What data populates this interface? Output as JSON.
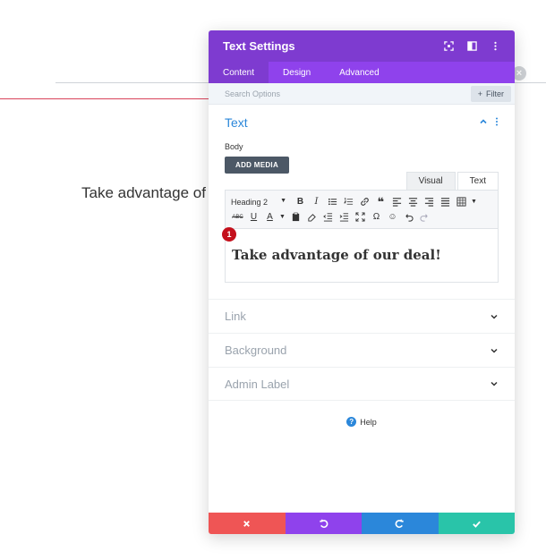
{
  "background": {
    "text": "Take advantage of our deal!"
  },
  "modal": {
    "title": "Text Settings",
    "tabs": [
      {
        "label": "Content"
      },
      {
        "label": "Design"
      },
      {
        "label": "Advanced"
      }
    ],
    "search": {
      "placeholder": "Search Options",
      "filter_label": "Filter"
    },
    "text_section": {
      "title": "Text",
      "body_label": "Body",
      "add_media_label": "ADD MEDIA",
      "editor_tabs": [
        "Visual",
        "Text"
      ],
      "format_select": "Heading 2",
      "badge": "1",
      "content": "Take advantage of our deal!"
    },
    "collapsed_sections": [
      {
        "label": "Link"
      },
      {
        "label": "Background"
      },
      {
        "label": "Admin Label"
      }
    ],
    "help_label": "Help"
  },
  "colors": {
    "header": "#7e3bd0",
    "tabs": "#8f42ec",
    "accent": "#2b87da",
    "cancel": "#ef5555",
    "undo": "#8f42ec",
    "redo": "#2b87da",
    "save": "#29c4a9",
    "badge": "#c4101c"
  }
}
